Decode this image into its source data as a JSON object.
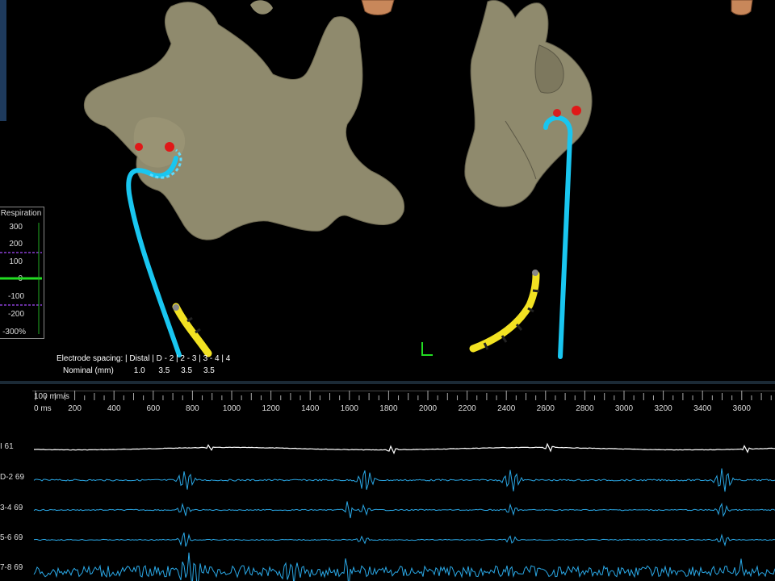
{
  "respiration": {
    "title": "Respiration",
    "ticks": [
      "300",
      "200",
      "100",
      "0",
      "-100",
      "-200",
      "-300%"
    ]
  },
  "electrode_spacing": {
    "row1": "Electrode spacing: | Distal | D - 2 | 2 - 3 | 3 - 4 | 4",
    "row2": "Nominal (mm)         1.0      3.5     3.5     3.5"
  },
  "ruler": {
    "speed": "100 mm/s",
    "zero": "0 ms",
    "ticks": [
      "200",
      "400",
      "600",
      "800",
      "1000",
      "1200",
      "1400",
      "1600",
      "1800",
      "2000",
      "2200",
      "2400",
      "2600",
      "2800",
      "3000",
      "3200",
      "3400",
      "3600"
    ]
  },
  "channels": [
    "I 61",
    "D-2 69",
    "3-4 69",
    "5-6 69",
    "7-8 69"
  ],
  "colors": {
    "chamber": "#8f8a6d",
    "catheter_blue": "#19c6f0",
    "catheter_yellow": "#f2e222",
    "marker_red": "#e01818",
    "egm_blue": "#2aa8e6",
    "surface_ecg": "#ffffff",
    "resp_green": "#22dd22",
    "resp_purple": "#8a3fd6"
  }
}
